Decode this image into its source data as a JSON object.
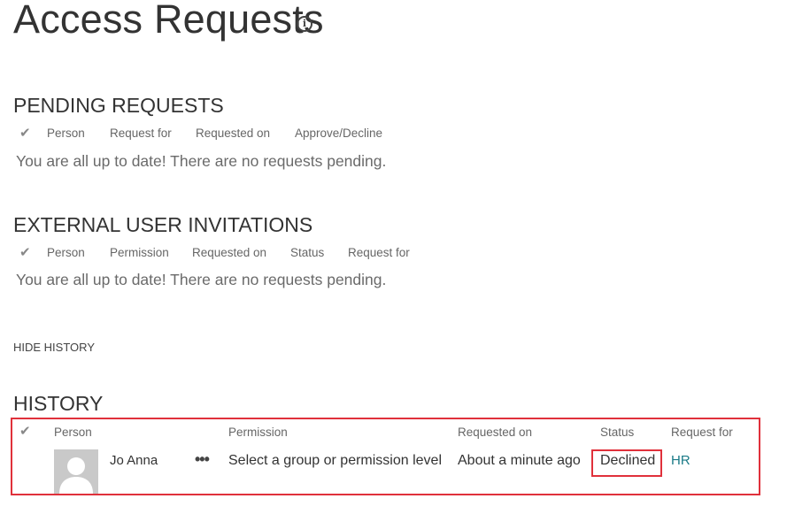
{
  "page": {
    "title": "Access Requests",
    "info_icon": "info-icon"
  },
  "pending": {
    "title": "PENDING REQUESTS",
    "columns": [
      "Person",
      "Request for",
      "Requested on",
      "Approve/Decline"
    ],
    "empty_message": "You are all up to date! There are no requests pending."
  },
  "external": {
    "title": "EXTERNAL USER INVITATIONS",
    "columns": [
      "Person",
      "Permission",
      "Requested on",
      "Status",
      "Request for"
    ],
    "empty_message": "You are all up to date! There are no requests pending."
  },
  "hide_history": "HIDE HISTORY",
  "history": {
    "title": "HISTORY",
    "columns": [
      "Person",
      "Permission",
      "Requested on",
      "Status",
      "Request for"
    ],
    "rows": [
      {
        "person": "Jo Anna",
        "more": "•••",
        "permission": "Select a group or permission level",
        "requested_on": "About a minute ago",
        "status": "Declined",
        "request_for": "HR"
      }
    ]
  },
  "colors": {
    "highlight": "#e0313b",
    "link": "#1a7a87"
  }
}
